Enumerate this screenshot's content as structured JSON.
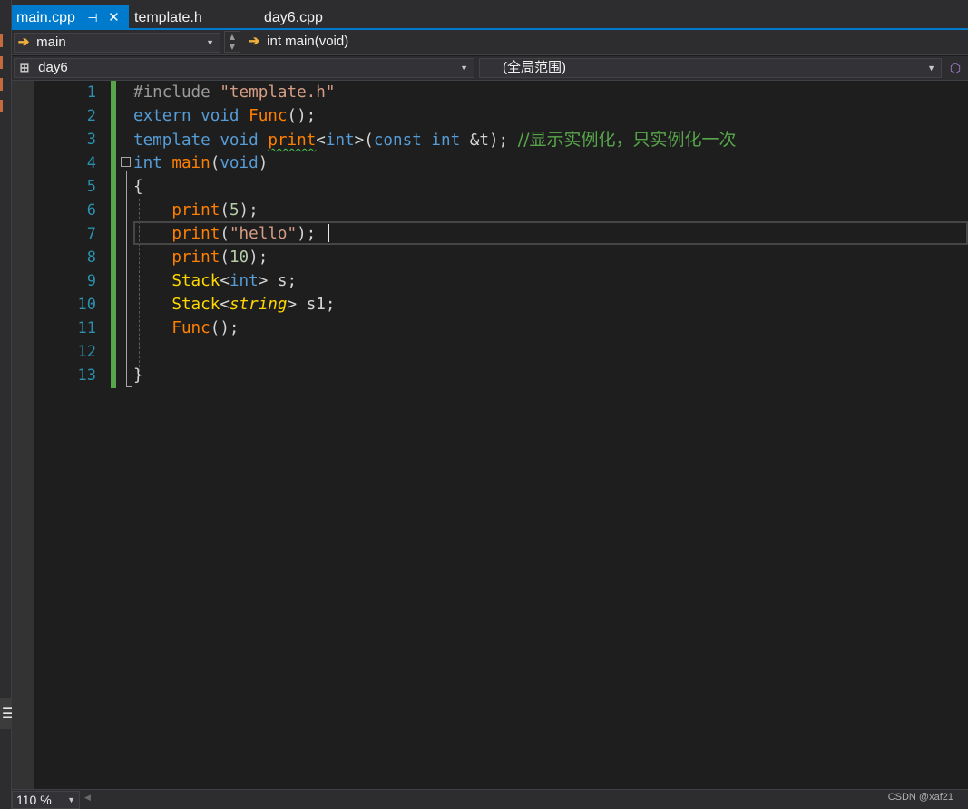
{
  "tabs": [
    {
      "label": "main.cpp",
      "active": true,
      "pin_icon": "pin-icon",
      "close_icon": "close-icon"
    },
    {
      "label": "template.h",
      "active": false
    },
    {
      "label": "day6.cpp",
      "active": false
    }
  ],
  "nav": {
    "scope_left": "main",
    "scope_right": "int main(void)",
    "project": "day6",
    "global_scope": "(全局范围)"
  },
  "editor": {
    "line_numbers": [
      "1",
      "2",
      "3",
      "4",
      "5",
      "6",
      "7",
      "8",
      "9",
      "10",
      "11",
      "12",
      "13"
    ],
    "lines": {
      "l1": {
        "directive": "#include ",
        "header": "\"template.h\""
      },
      "l2": {
        "kw1": "extern ",
        "kw2": "void ",
        "fn": "Func",
        "rest": "();"
      },
      "l3": {
        "kw1": "template ",
        "kw2": "void ",
        "fn": "print",
        "lt": "<",
        "kw3": "int",
        "gt": ">",
        "open": "(",
        "kw4": "const ",
        "kw5": "int ",
        "amp": "&",
        "param": "t",
        "close": "); ",
        "comment": "//显示实例化，只实例化一次"
      },
      "l4": {
        "kw": "int ",
        "fn": "main",
        "open": "(",
        "kw2": "void",
        "close": ")"
      },
      "l5": {
        "brace": "{"
      },
      "l6": {
        "fn": "print",
        "open": "(",
        "num": "5",
        "close": ");"
      },
      "l7": {
        "fn": "print",
        "open": "(",
        "str": "\"hello\"",
        "close": ");"
      },
      "l8": {
        "fn": "print",
        "open": "(",
        "num": "10",
        "close": ");"
      },
      "l9": {
        "type": "Stack",
        "lt": "<",
        "kw": "int",
        "gt": "> ",
        "var": "s",
        "semi": ";"
      },
      "l10": {
        "type": "Stack",
        "lt": "<",
        "type2": "string",
        "gt": "> ",
        "var": "s1",
        "semi": ";"
      },
      "l11": {
        "fn": "Func",
        "rest": "();"
      },
      "l13": {
        "brace": "}"
      }
    }
  },
  "status": {
    "zoom": "110 %",
    "watermark": "CSDN @xaf21"
  },
  "colors": {
    "accent": "#007acc",
    "background": "#1e1e1e",
    "keyword": "#569cd6",
    "function": "#ff8000",
    "type": "#ffd700",
    "comment": "#57a64a",
    "string": "#d69d85",
    "line_number": "#2b91af"
  }
}
